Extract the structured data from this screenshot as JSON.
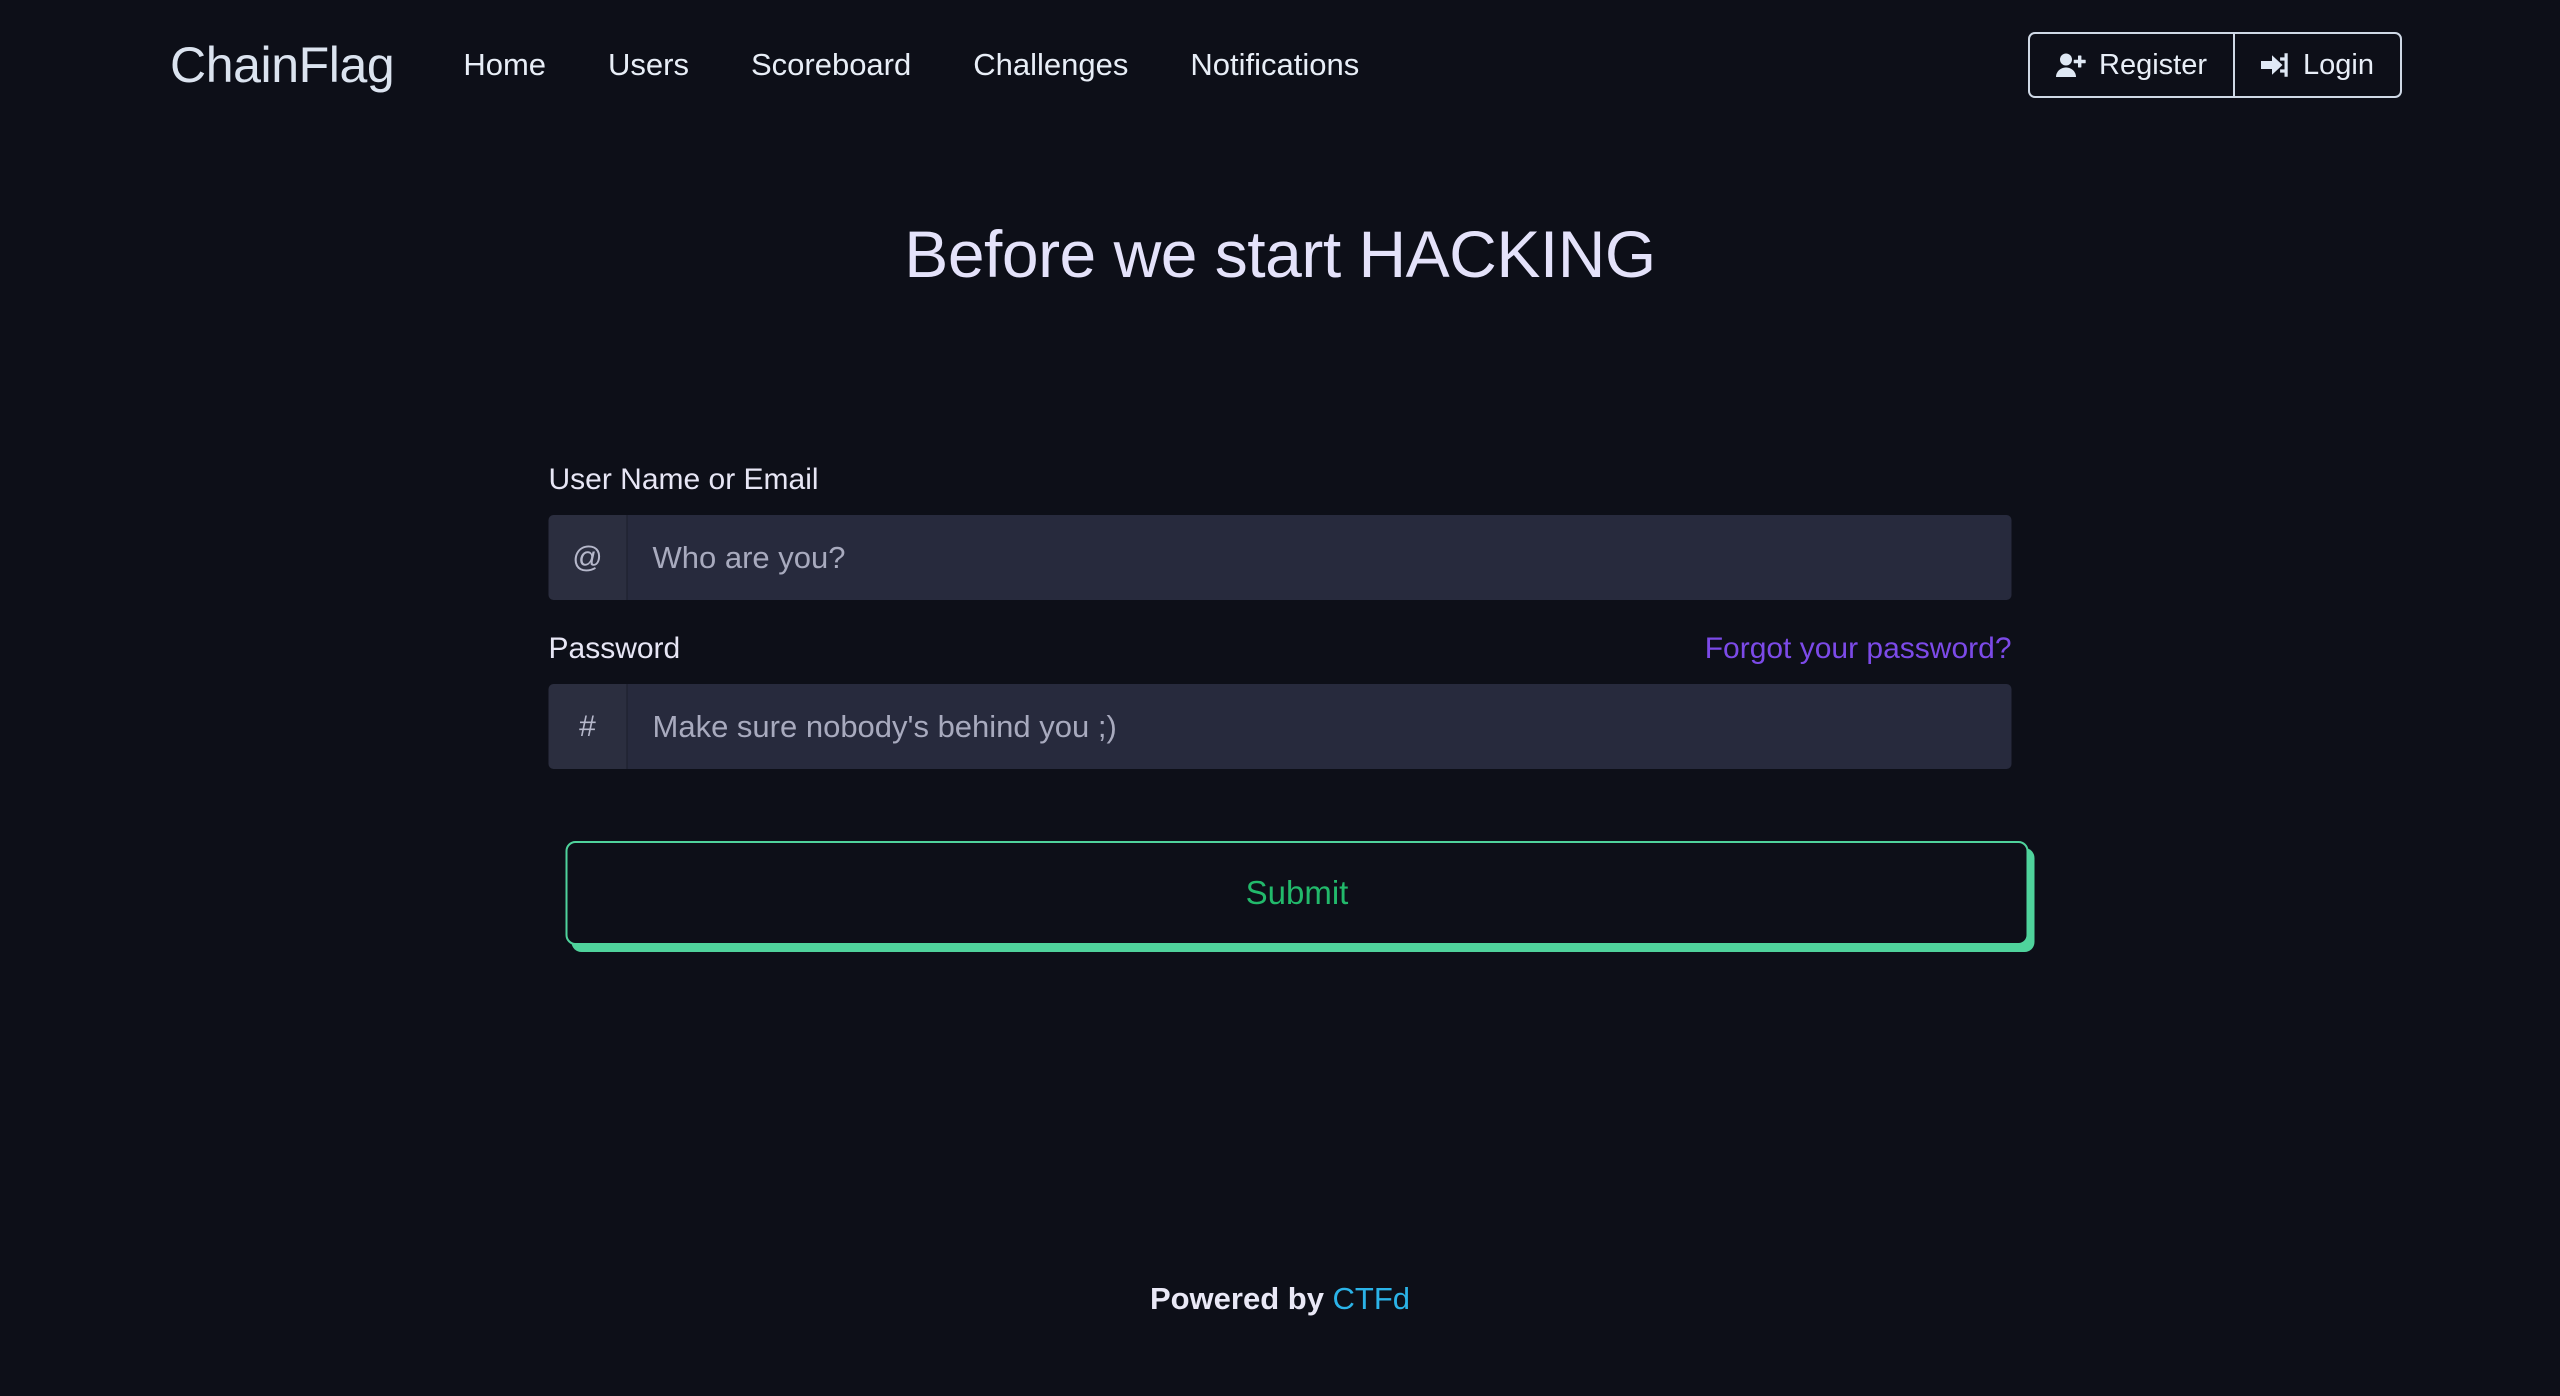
{
  "theme": {
    "background": "#0d0f18",
    "input_background": "#272a3d",
    "addon_background": "#2b2e3f",
    "heading_color": "#e4e2fa",
    "link_violet": "#7c4ae8",
    "accent_green": "#4fd39c",
    "submit_text_green": "#22b96b",
    "footer_link_cyan": "#2bb3e8",
    "nav_text": "#e8eef7"
  },
  "navbar": {
    "brand": "ChainFlag",
    "links": [
      {
        "label": "Home"
      },
      {
        "label": "Users"
      },
      {
        "label": "Scoreboard"
      },
      {
        "label": "Challenges"
      },
      {
        "label": "Notifications"
      }
    ],
    "register": {
      "label": "Register",
      "icon": "user-plus-icon"
    },
    "login": {
      "label": "Login",
      "icon": "sign-in-icon"
    }
  },
  "hero": {
    "title": "Before we start HACKING"
  },
  "form": {
    "username": {
      "label": "User Name or Email",
      "addon": "@",
      "placeholder": "Who are you?",
      "value": ""
    },
    "password": {
      "label": "Password",
      "addon": "#",
      "placeholder": "Make sure nobody's behind you ;)",
      "value": "",
      "forgot_label": "Forgot your password?"
    },
    "submit_label": "Submit"
  },
  "footer": {
    "prefix": "Powered by ",
    "link_label": "CTFd"
  }
}
